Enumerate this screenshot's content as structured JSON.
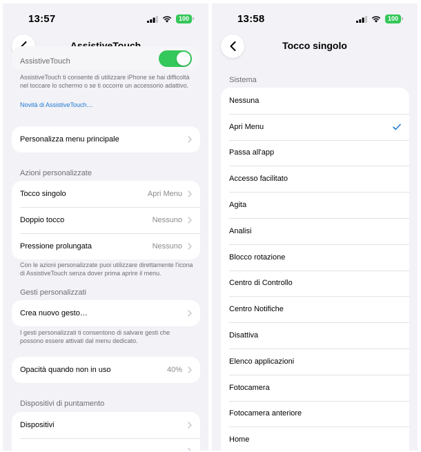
{
  "left": {
    "status": {
      "time": "13:57",
      "battery": "100"
    },
    "nav": {
      "title": "AssistiveTouch"
    },
    "toggle_row": {
      "label": "AssistiveTouch",
      "state": "on"
    },
    "intro_text": "AssistiveTouch ti consente di utilizzare iPhone se hai difficoltà nel toccare lo schermo o se ti occorre un accessorio adattivo.",
    "intro_link": "Novità di AssistiveTouch…",
    "main_menu": {
      "label": "Personalizza menu principale"
    },
    "custom_actions": {
      "header": "Azioni personalizzate",
      "rows": [
        {
          "label": "Tocco singolo",
          "value": "Apri Menu"
        },
        {
          "label": "Doppio tocco",
          "value": "Nessuno"
        },
        {
          "label": "Pressione prolungata",
          "value": "Nessuno"
        }
      ],
      "footer": "Con le azioni personalizzate puoi utilizzare direttamente l'icona di AssistiveTouch senza dover prima aprire il menu."
    },
    "custom_gestures": {
      "header": "Gesti personalizzati",
      "row": {
        "label": "Crea nuovo gesto…"
      },
      "footer": "I gesti personalizzati ti consentono di salvare gesti che possono essere attivati dal menu dedicato."
    },
    "opacity": {
      "label": "Opacità quando non in uso",
      "value": "40%"
    },
    "pointing": {
      "header": "Dispositivi di puntamento",
      "rows": [
        {
          "label": "Dispositivi"
        }
      ]
    }
  },
  "right": {
    "status": {
      "time": "13:58",
      "battery": "100"
    },
    "nav": {
      "title": "Tocco singolo"
    },
    "section_header": "Sistema",
    "selected_item": "Apri Menu",
    "items": [
      "Nessuna",
      "Apri Menu",
      "Passa all'app",
      "Accesso facilitato",
      "Agita",
      "Analisi",
      "Blocco rotazione",
      "Centro di Controllo",
      "Centro Notifiche",
      "Disattiva",
      "Elenco applicazioni",
      "Fotocamera",
      "Fotocamera anteriore",
      "Home"
    ]
  },
  "colors": {
    "background": "#f2f2f7",
    "card": "#ffffff",
    "accent": "#1f7ad1",
    "toggle_on": "#34c759",
    "secondary_text": "#8a8a8e"
  }
}
